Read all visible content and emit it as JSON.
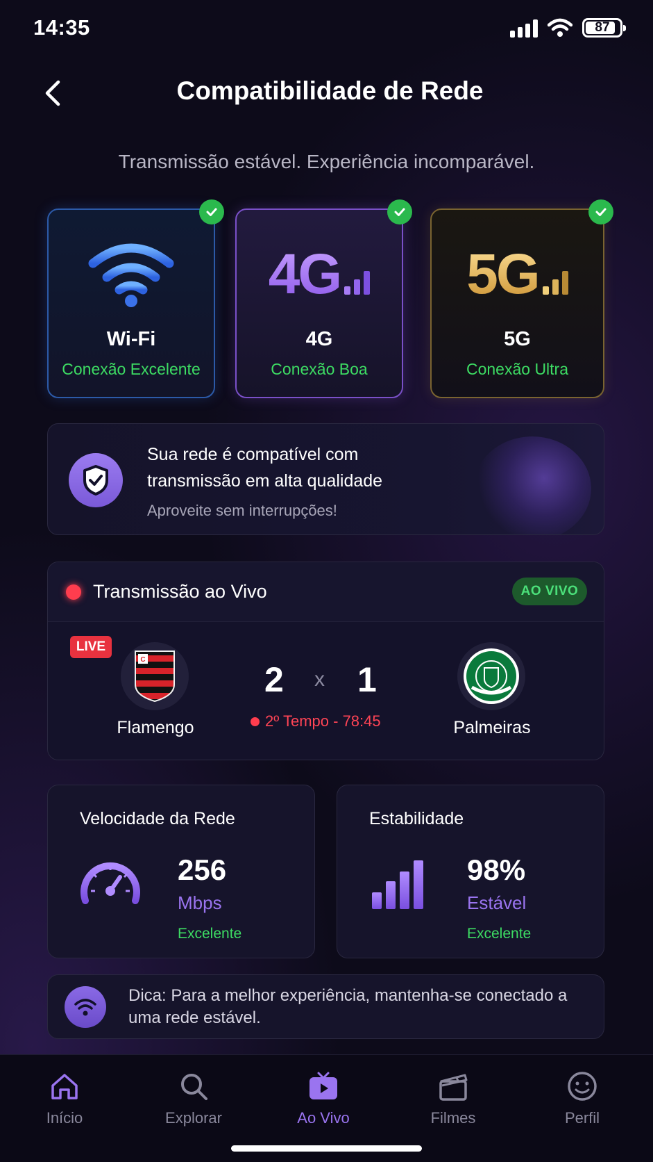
{
  "status_bar": {
    "time": "14:35",
    "battery": "87"
  },
  "header": {
    "title": "Compatibilidade de Rede",
    "subtitle": "Transmissão estável. Experiência incomparável."
  },
  "networks": [
    {
      "name": "Wi-Fi",
      "status": "Conexão Excelente",
      "icon": "wifi-icon"
    },
    {
      "name": "4G",
      "status": "Conexão Boa",
      "badge": "4G",
      "icon": "signal-bars-icon"
    },
    {
      "name": "5G",
      "status": "Conexão Ultra",
      "badge": "5G",
      "icon": "signal-bars-icon"
    }
  ],
  "compat": {
    "line1": "Sua rede é compatível com",
    "line2": "transmissão em alta qualidade",
    "sub": "Aproveite sem interrupções!"
  },
  "live": {
    "title": "Transmissão ao Vivo",
    "badge": "AO VIVO",
    "tag": "LIVE",
    "home_team": "Flamengo",
    "away_team": "Palmeiras",
    "home_score": "2",
    "separator": "x",
    "away_score": "1",
    "match_time": "2º Tempo - 78:45"
  },
  "stats": {
    "speed": {
      "title": "Velocidade da Rede",
      "value": "256",
      "unit": "Mbps",
      "quality": "Excelente"
    },
    "stability": {
      "title": "Estabilidade",
      "value": "98%",
      "unit": "Estável",
      "quality": "Excelente"
    }
  },
  "tip": {
    "text": "Dica: Para a melhor experiência, mantenha-se conectado a uma rede estável."
  },
  "nav": [
    {
      "label": "Início",
      "icon": "home-icon"
    },
    {
      "label": "Explorar",
      "icon": "search-icon"
    },
    {
      "label": "Ao Vivo",
      "icon": "tv-play-icon"
    },
    {
      "label": "Filmes",
      "icon": "clapperboard-icon"
    },
    {
      "label": "Perfil",
      "icon": "smiley-icon"
    }
  ],
  "colors": {
    "accent": "#9a74f0",
    "success": "#3ddc63",
    "live": "#ff3d4e",
    "background": "#0d0b1a"
  }
}
